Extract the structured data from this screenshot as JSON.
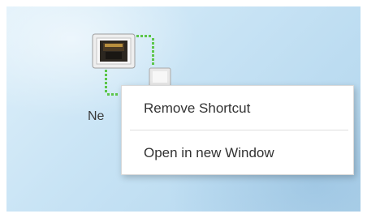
{
  "desktop": {
    "icon_name": "network-adapter-icon",
    "shortcut_label": "Ne"
  },
  "context_menu": {
    "items": [
      {
        "label": "Remove Shortcut"
      },
      {
        "label": "Open in new Window"
      }
    ]
  },
  "colors": {
    "link_dots": "#5cc64a",
    "desktop_bg": "#c9e4f5",
    "menu_bg": "#ffffff",
    "menu_text": "#333333"
  }
}
